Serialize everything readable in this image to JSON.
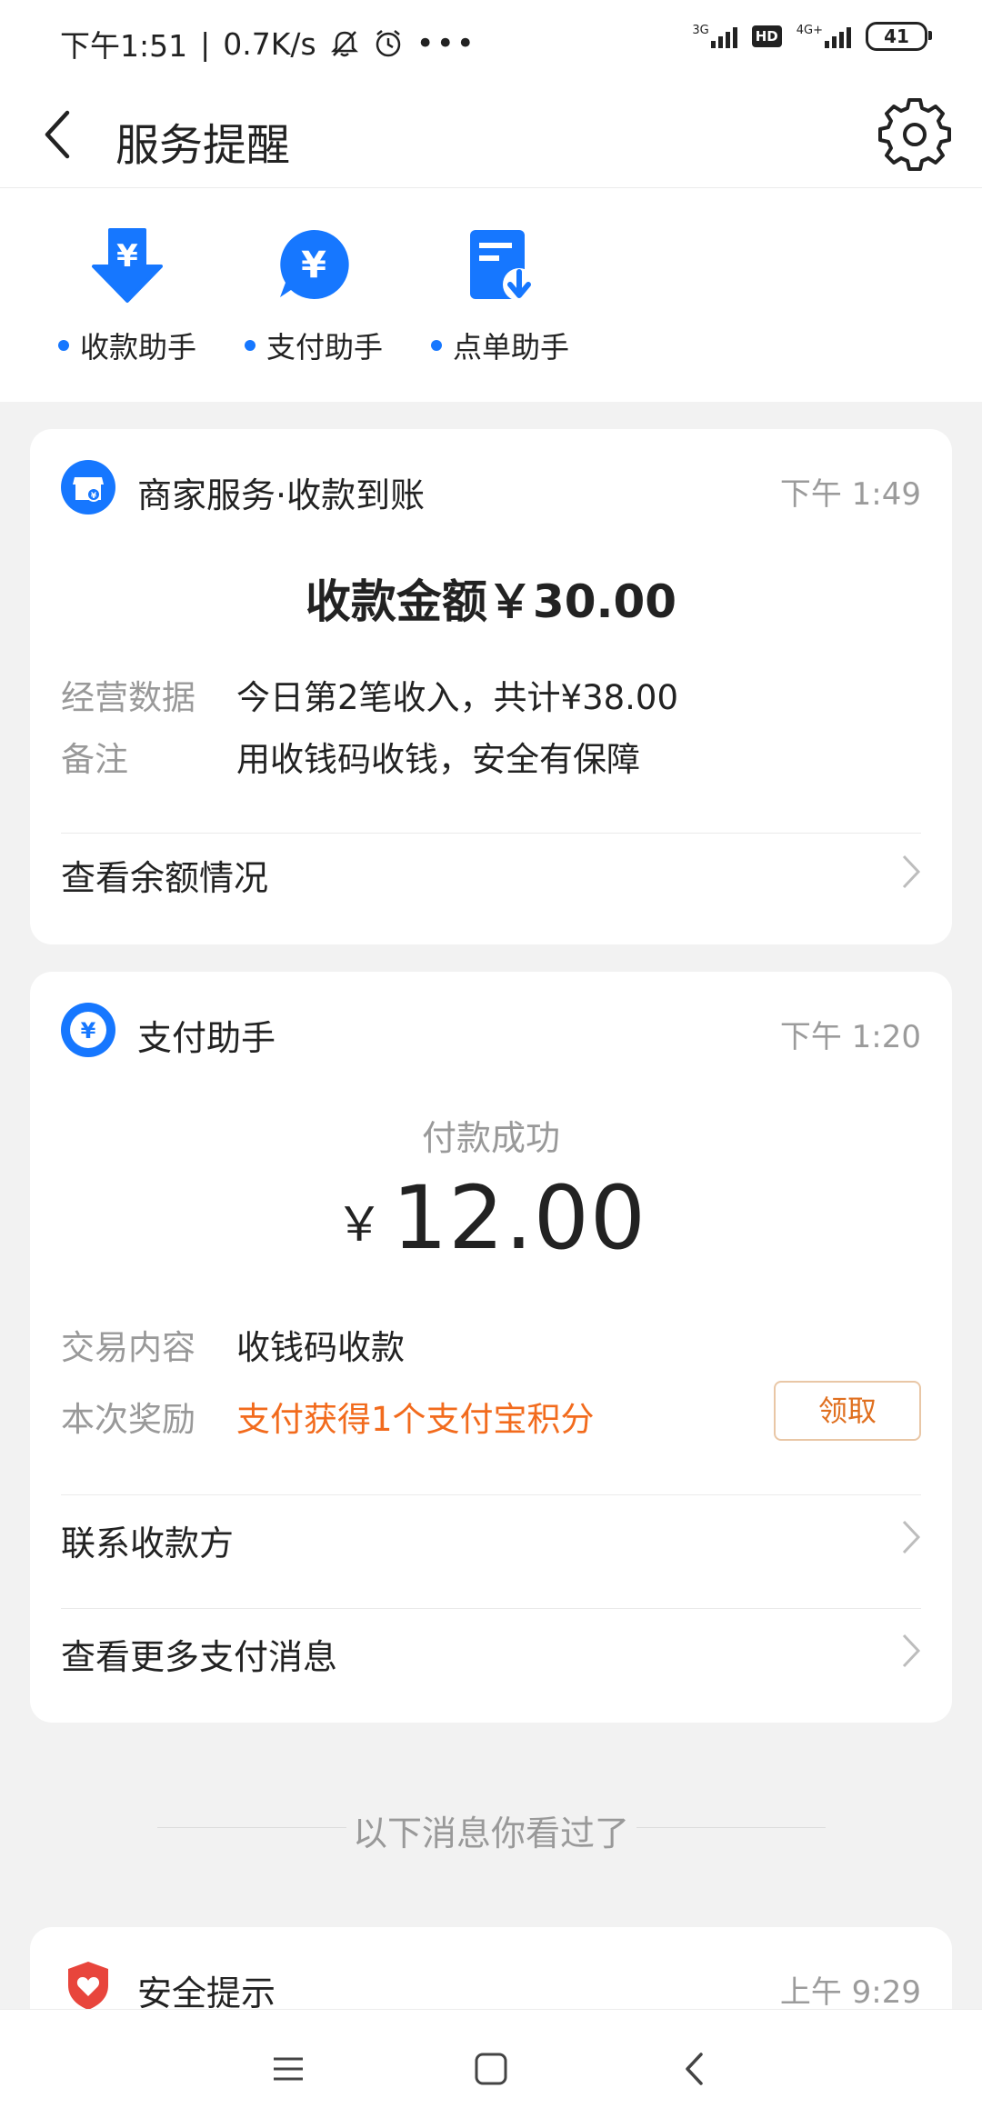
{
  "status_bar": {
    "time": "下午1:51",
    "speed": "0.7K/s",
    "net1": "3G",
    "hd": "HD",
    "net2": "4G+",
    "battery": "41"
  },
  "header": {
    "title": "服务提醒"
  },
  "helpers": [
    {
      "label": "收款助手",
      "icon": "download-yen-icon"
    },
    {
      "label": "支付助手",
      "icon": "yen-bubble-icon"
    },
    {
      "label": "点单助手",
      "icon": "order-icon"
    }
  ],
  "card1": {
    "title": "商家服务·收款到账",
    "time": "下午 1:49",
    "amount": "收款金额￥30.00",
    "rows": [
      {
        "key": "经营数据",
        "value": "今日第2笔收入，共计¥38.00"
      },
      {
        "key": "备注",
        "value": "用收钱码收钱，安全有保障"
      }
    ],
    "link": "查看余额情况"
  },
  "card2": {
    "title": "支付助手",
    "time": "下午 1:20",
    "status": "付款成功",
    "currency": "￥",
    "amount": "12.00",
    "rows": [
      {
        "key": "交易内容",
        "value": "收钱码收款"
      },
      {
        "key": "本次奖励",
        "value": "支付获得1个支付宝积分"
      }
    ],
    "claim": "领取",
    "links": [
      "联系收款方",
      "查看更多支付消息"
    ]
  },
  "seen_text": "以下消息你看过了",
  "card3": {
    "title": "安全提示",
    "time": "上午 9:29"
  },
  "colors": {
    "accent": "#1677ff",
    "orange": "#f26b1d",
    "danger": "#e8453c"
  }
}
